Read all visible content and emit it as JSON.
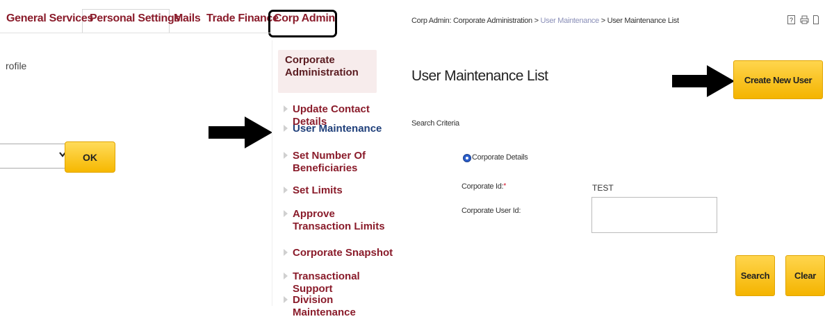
{
  "topnav": {
    "items": [
      "General Services",
      "Personal Settings",
      "Mails",
      "Trade Finance",
      "Corp Admin"
    ]
  },
  "left": {
    "profile_text": "rofile",
    "ok_label": "OK"
  },
  "menu": {
    "header": "Corporate Administration",
    "items": [
      "Update Contact Details",
      "User Maintenance",
      "Set Number Of Beneficiaries",
      "Set Limits",
      "Approve Transaction Limits",
      "Corporate Snapshot",
      "Transactional Support",
      "Division Maintenance"
    ]
  },
  "right": {
    "breadcrumb": {
      "part1": "Corp Admin: Corporate Administration > ",
      "part2": "User Maintenance",
      "part3": " > User Maintenance List"
    },
    "icons_text": "? ⎙ ⎙",
    "page_title": "User Maintenance List",
    "create_label": "Create New User",
    "search_criteria": "Search Criteria",
    "radio_label": "Corporate Details",
    "corp_id_label": "Corporate Id:",
    "corp_id_required": "*",
    "corp_id_value": "TEST",
    "corp_user_id_label": "Corporate User Id:",
    "search_label": "Search",
    "clear_label": "Clear"
  },
  "colors": {
    "nav_text": "#8a1c2b",
    "button_yellow": "#f6b800",
    "radio_blue": "#2c5fcc"
  }
}
